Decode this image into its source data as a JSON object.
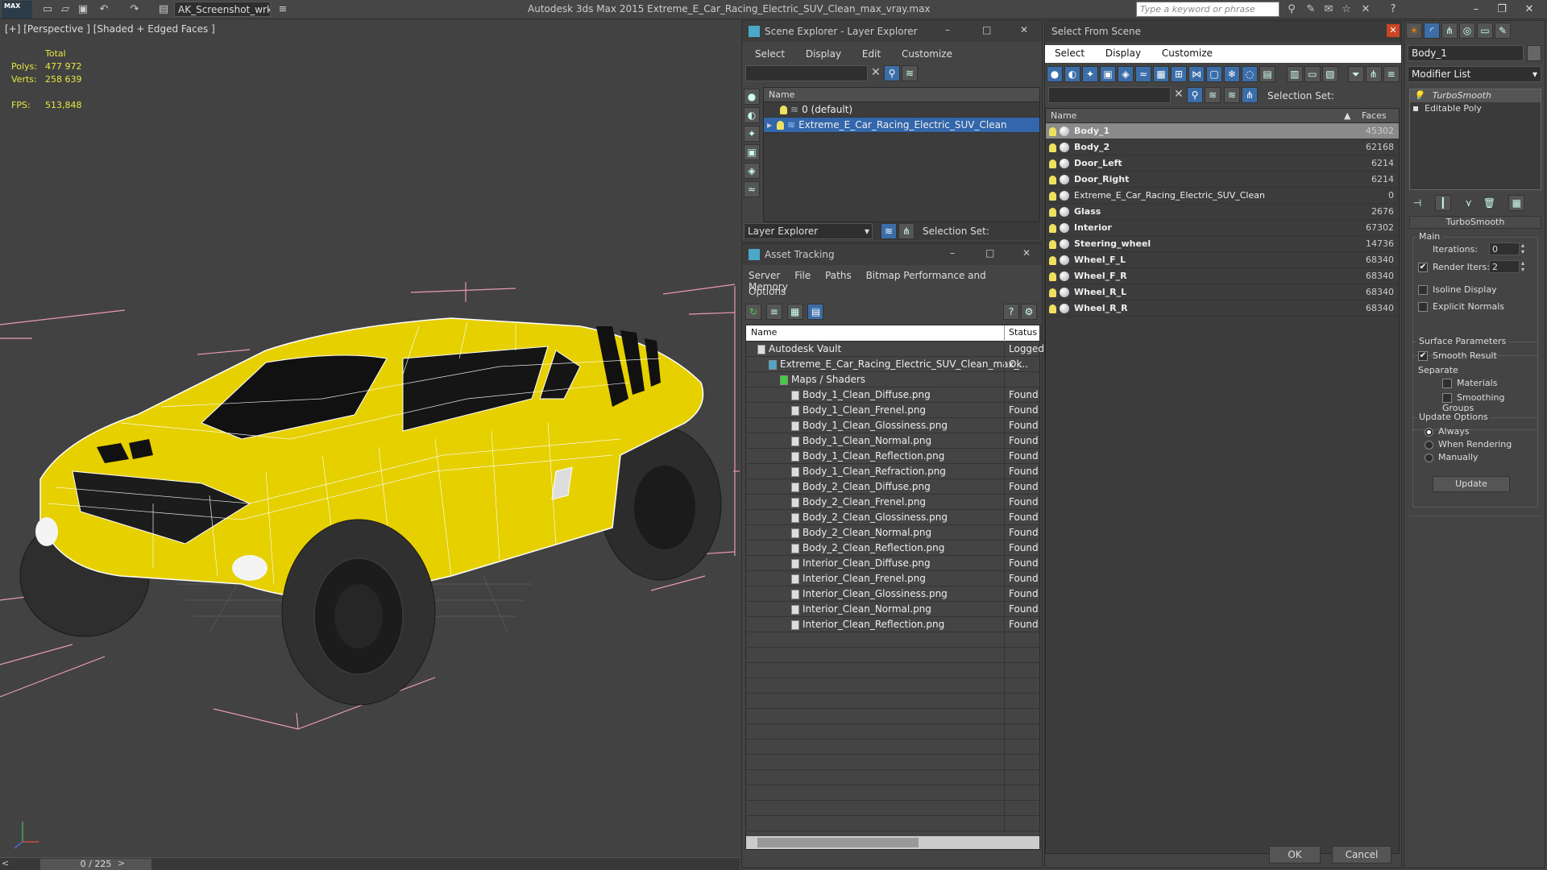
{
  "app": {
    "logo": "MAX",
    "workspace": "AK_Screenshot_wrksp",
    "title": "Autodesk 3ds Max  2015     Extreme_E_Car_Racing_Electric_SUV_Clean_max_vray.max",
    "search_placeholder": "Type a keyword or phrase"
  },
  "viewport": {
    "label": "[+] [Perspective ] [Shaded + Edged Faces ]",
    "stats_header": "Total",
    "polys_label": "Polys:",
    "polys": "477 972",
    "verts_label": "Verts:",
    "verts": "258 639",
    "fps_label": "FPS:",
    "fps": "513,848",
    "timeline": "0 / 225",
    "colors": {
      "car_body": "#e6d000",
      "wire": "#ffffff",
      "tire": "#2a2a2a"
    }
  },
  "scene_explorer": {
    "title": "Scene Explorer - Layer Explorer",
    "menu": [
      "Select",
      "Display",
      "Edit",
      "Customize"
    ],
    "column": "Name",
    "rows": [
      "0 (default)",
      "Extreme_E_Car_Racing_Electric_SUV_Clean"
    ],
    "footer_dropdown": "Layer Explorer",
    "selection_set": "Selection Set:"
  },
  "asset_tracking": {
    "title": "Asset Tracking",
    "menu": [
      "Server",
      "File",
      "Paths",
      "Bitmap Performance and Memory"
    ],
    "menu2": "Options",
    "col_name": "Name",
    "col_status": "Status",
    "rows": [
      {
        "name": "Autodesk Vault",
        "status": "Logged",
        "level": 0
      },
      {
        "name": "Extreme_E_Car_Racing_Electric_SUV_Clean_max_...",
        "status": "Ok",
        "level": 1
      },
      {
        "name": "Maps / Shaders",
        "status": "",
        "level": 2
      },
      {
        "name": "Body_1_Clean_Diffuse.png",
        "status": "Found",
        "level": 3
      },
      {
        "name": "Body_1_Clean_Frenel.png",
        "status": "Found",
        "level": 3
      },
      {
        "name": "Body_1_Clean_Glossiness.png",
        "status": "Found",
        "level": 3
      },
      {
        "name": "Body_1_Clean_Normal.png",
        "status": "Found",
        "level": 3
      },
      {
        "name": "Body_1_Clean_Reflection.png",
        "status": "Found",
        "level": 3
      },
      {
        "name": "Body_1_Clean_Refraction.png",
        "status": "Found",
        "level": 3
      },
      {
        "name": "Body_2_Clean_Diffuse.png",
        "status": "Found",
        "level": 3
      },
      {
        "name": "Body_2_Clean_Frenel.png",
        "status": "Found",
        "level": 3
      },
      {
        "name": "Body_2_Clean_Glossiness.png",
        "status": "Found",
        "level": 3
      },
      {
        "name": "Body_2_Clean_Normal.png",
        "status": "Found",
        "level": 3
      },
      {
        "name": "Body_2_Clean_Reflection.png",
        "status": "Found",
        "level": 3
      },
      {
        "name": "Interior_Clean_Diffuse.png",
        "status": "Found",
        "level": 3
      },
      {
        "name": "Interior_Clean_Frenel.png",
        "status": "Found",
        "level": 3
      },
      {
        "name": "Interior_Clean_Glossiness.png",
        "status": "Found",
        "level": 3
      },
      {
        "name": "Interior_Clean_Normal.png",
        "status": "Found",
        "level": 3
      },
      {
        "name": "Interior_Clean_Reflection.png",
        "status": "Found",
        "level": 3
      }
    ]
  },
  "select_from_scene": {
    "title": "Select From Scene",
    "menu": [
      "Select",
      "Display",
      "Customize"
    ],
    "selection_set": "Selection Set:",
    "col_name": "Name",
    "col_faces": "Faces",
    "rows": [
      {
        "name": "Body_1",
        "faces": "45302",
        "bold": true,
        "selected": true
      },
      {
        "name": "Body_2",
        "faces": "62168",
        "bold": true
      },
      {
        "name": "Door_Left",
        "faces": "6214",
        "bold": true
      },
      {
        "name": "Door_Right",
        "faces": "6214",
        "bold": true
      },
      {
        "name": "Extreme_E_Car_Racing_Electric_SUV_Clean",
        "faces": "0",
        "bold": false
      },
      {
        "name": "Glass",
        "faces": "2676",
        "bold": true
      },
      {
        "name": "Interior",
        "faces": "67302",
        "bold": true
      },
      {
        "name": "Steering_wheel",
        "faces": "14736",
        "bold": true
      },
      {
        "name": "Wheel_F_L",
        "faces": "68340",
        "bold": true
      },
      {
        "name": "Wheel_F_R",
        "faces": "68340",
        "bold": true
      },
      {
        "name": "Wheel_R_L",
        "faces": "68340",
        "bold": true
      },
      {
        "name": "Wheel_R_R",
        "faces": "68340",
        "bold": true
      }
    ],
    "ok": "OK",
    "cancel": "Cancel"
  },
  "modify_panel": {
    "object_name": "Body_1",
    "modifier_list": "Modifier List",
    "stack": [
      "TurboSmooth",
      "Editable Poly"
    ],
    "rollout_title": "TurboSmooth",
    "main": "Main",
    "iterations_label": "Iterations:",
    "iterations": "0",
    "render_iters_label": "Render Iters:",
    "render_iters": "2",
    "render_iters_checked": true,
    "isoline": "Isoline Display",
    "explicit_normals": "Explicit Normals",
    "surface_params": "Surface Parameters",
    "smooth_result": "Smooth Result",
    "separate": "Separate",
    "materials": "Materials",
    "smoothing_groups": "Smoothing Groups",
    "update_options": "Update Options",
    "always": "Always",
    "when_rendering": "When Rendering",
    "manually": "Manually",
    "update": "Update"
  }
}
